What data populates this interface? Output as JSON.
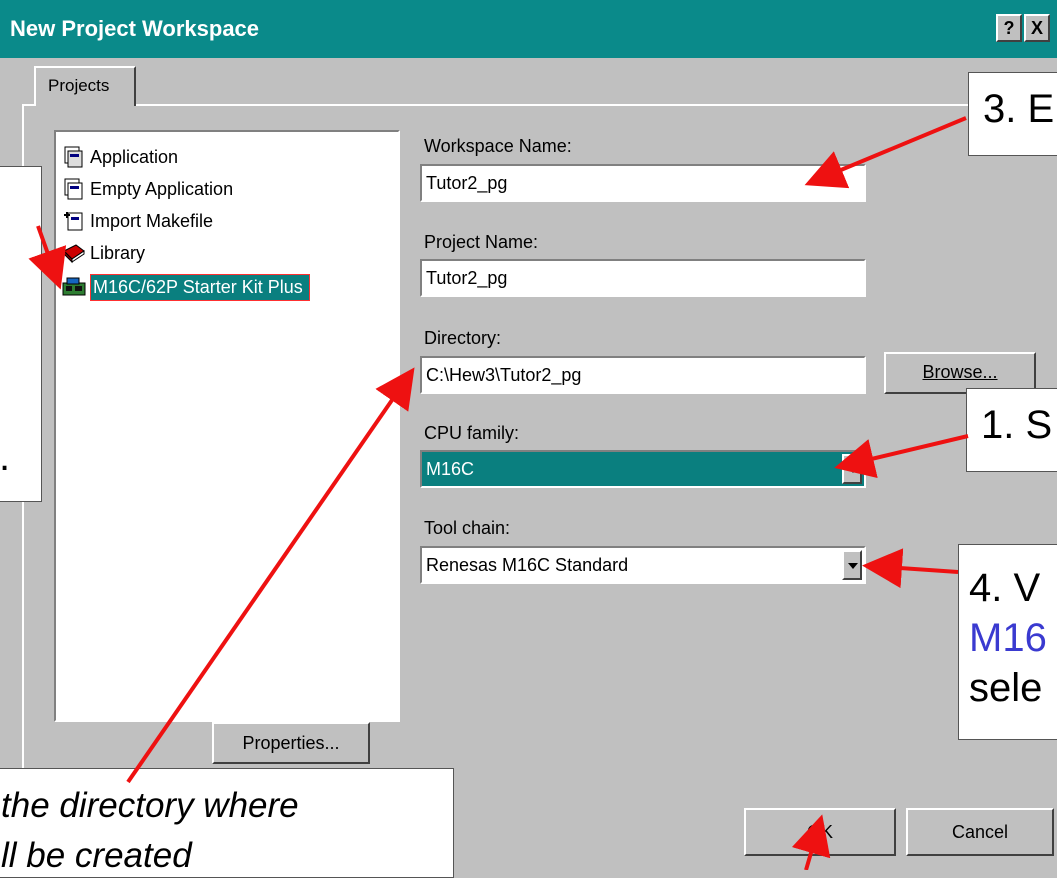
{
  "window": {
    "title": "New Project Workspace",
    "help_label": "?",
    "close_label": "X"
  },
  "tabs": [
    {
      "label": "Projects"
    }
  ],
  "project_types": [
    {
      "label": "Application",
      "icon": "application-icon"
    },
    {
      "label": "Empty Application",
      "icon": "empty-application-icon"
    },
    {
      "label": "Import Makefile",
      "icon": "import-makefile-icon"
    },
    {
      "label": "Library",
      "icon": "library-icon"
    },
    {
      "label": "M16C/62P Starter Kit Plus",
      "icon": "board-icon",
      "selected": true
    }
  ],
  "form": {
    "workspace_name_label": "Workspace Name:",
    "workspace_name_value": "Tutor2_pg",
    "project_name_label": "Project Name:",
    "project_name_value": "Tutor2_pg",
    "directory_label": "Directory:",
    "directory_value": "C:\\Hew3\\Tutor2_pg",
    "browse_label": "Browse...",
    "cpu_family_label": "CPU family:",
    "cpu_family_value": "M16C",
    "tool_chain_label": "Tool chain:",
    "tool_chain_value": "Renesas M16C Standard"
  },
  "buttons": {
    "properties_label": "Properties...",
    "ok_label": "OK",
    "cancel_label": "Cancel"
  },
  "callouts": {
    "step3": "3. E",
    "step1": "1. S",
    "step4_line1": "4. V",
    "step4_line2": "M16",
    "step4_line3": "sele",
    "left_box_text": ".",
    "bottom_line1": "the directory where",
    "bottom_line2": "ll be created"
  },
  "colors": {
    "titlebar": "#0a8a8a",
    "selection": "#0a7f7f",
    "arrow": "#ee1111",
    "callout_blue": "#3a3ad0"
  }
}
